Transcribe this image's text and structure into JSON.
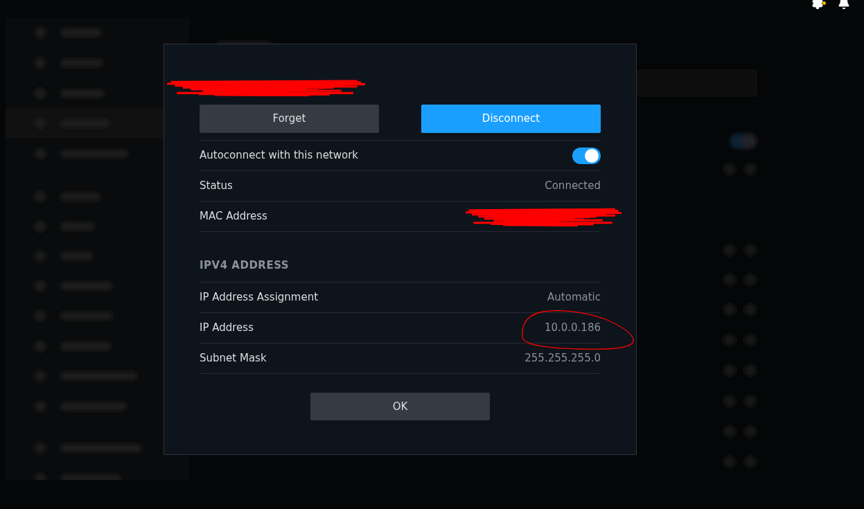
{
  "top_icons": [
    {
      "kind": "gear",
      "alert": true
    },
    {
      "kind": "bell",
      "alert": false
    }
  ],
  "dialog": {
    "network_name": {
      "redacted": true
    },
    "buttons": [
      {
        "label": "Forget",
        "primary": false
      },
      {
        "label": "Disconnect",
        "primary": true
      }
    ],
    "rows": [
      {
        "kind": "toggle",
        "label": "Autoconnect with this network",
        "on": true
      },
      {
        "kind": "value",
        "label": "Status",
        "value": "Connected"
      },
      {
        "kind": "redacted",
        "label": "MAC Address"
      }
    ],
    "ipv4": {
      "heading": "IPV4 ADDRESS",
      "rows": [
        {
          "kind": "value",
          "label": "IP Address Assignment",
          "value": "Automatic",
          "circled": false
        },
        {
          "kind": "value",
          "label": "IP Address",
          "value": "10.0.0.186",
          "circled": true
        },
        {
          "kind": "value",
          "label": "Subnet Mask",
          "value": "255.255.255.0",
          "circled": false
        }
      ]
    },
    "ok_button": {
      "label": "OK"
    }
  }
}
